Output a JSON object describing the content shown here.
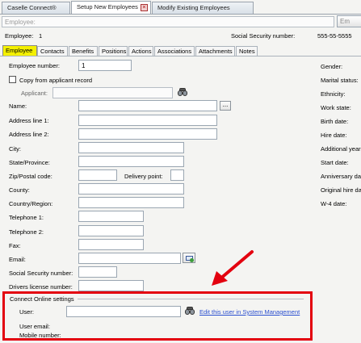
{
  "doc_tabs": [
    {
      "label": "Caselle Connect®"
    },
    {
      "label": "Setup New Employees"
    },
    {
      "label": "Modify Existing Employees"
    }
  ],
  "close_icon": "×",
  "header": {
    "employee_search_placeholder": "Employee:",
    "right_button": "Em",
    "employee_label": "Employee:",
    "employee_value": "1",
    "ssn_label": "Social Security number:",
    "ssn_value": "555-55-5555"
  },
  "tabs": [
    "Employee",
    "Contacts",
    "Benefits",
    "Positions",
    "Actions",
    "Associations",
    "Attachments",
    "Notes"
  ],
  "form": {
    "employee_number_label": "Employee number:",
    "employee_number_value": "1",
    "copy_label": "Copy from applicant record",
    "applicant_label": "Applicant:",
    "name_label": "Name:",
    "ellipsis": "...",
    "address1_label": "Address line 1:",
    "address2_label": "Address line 2:",
    "city_label": "City:",
    "state_label": "State/Province:",
    "zip_label": "Zip/Postal code:",
    "delivery_label": "Delivery point:",
    "county_label": "County:",
    "country_label": "Country/Region:",
    "tel1_label": "Telephone 1:",
    "tel2_label": "Telephone 2:",
    "fax_label": "Fax:",
    "email_label": "Email:",
    "ssn_label": "Social Security number:",
    "dl_label": "Drivers license number:"
  },
  "right_labels": [
    "Gender:",
    "Marital status:",
    "Ethnicity:",
    "Work state:",
    "Birth date:",
    "Hire date:",
    "Additional year",
    "Start date:",
    "Anniversary da",
    "Original hire da",
    "W-4 date:"
  ],
  "connect": {
    "group_title": "Connect Online settings",
    "user_label": "User:",
    "link_text": "Edit this user in System Management",
    "email_label": "User email:",
    "mobile_label": "Mobile number:"
  },
  "colors": {
    "highlight_tab": "#f4f000",
    "annotation_red": "#e3000f",
    "link": "#2a4fd0"
  },
  "icons": {
    "binoculars": "binoculars-icon",
    "email": "email-icon",
    "arrow": "red-arrow-icon"
  }
}
